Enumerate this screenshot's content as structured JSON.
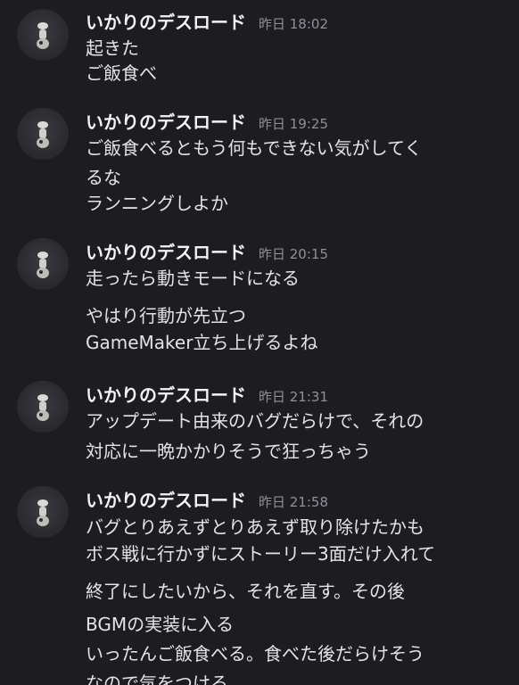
{
  "channel": {
    "messages": [
      {
        "author": "いかりのデスロード",
        "timestamp": "昨日 18:02",
        "lines": [
          "起きた",
          "ご飯食べ"
        ]
      },
      {
        "author": "いかりのデスロード",
        "timestamp": "昨日 19:25",
        "lines": [
          "ご飯食べるともう何もできない気がしてく",
          "るな",
          "ランニングしよか"
        ]
      },
      {
        "author": "いかりのデスロード",
        "timestamp": "昨日 20:15",
        "lines": [
          "走ったら動きモードになる",
          "やはり行動が先立つ",
          "GameMaker立ち上げるよね"
        ]
      },
      {
        "author": "いかりのデスロード",
        "timestamp": "昨日 21:31",
        "lines": [
          "アップデート由来のバグだらけで、それの",
          "対応に一晩かかりそうで狂っちゃう"
        ]
      },
      {
        "author": "いかりのデスロード",
        "timestamp": "昨日 21:58",
        "lines": [
          "バグとりあえずとりあえず取り除けたかも",
          "ボス戦に行かずにストーリー3面だけ入れて",
          "終了にしたいから、それを直す。その後",
          "BGMの実装に入る",
          "いったんご飯食べる。食べた後だらけそう",
          "なので気をつける"
        ]
      }
    ]
  }
}
